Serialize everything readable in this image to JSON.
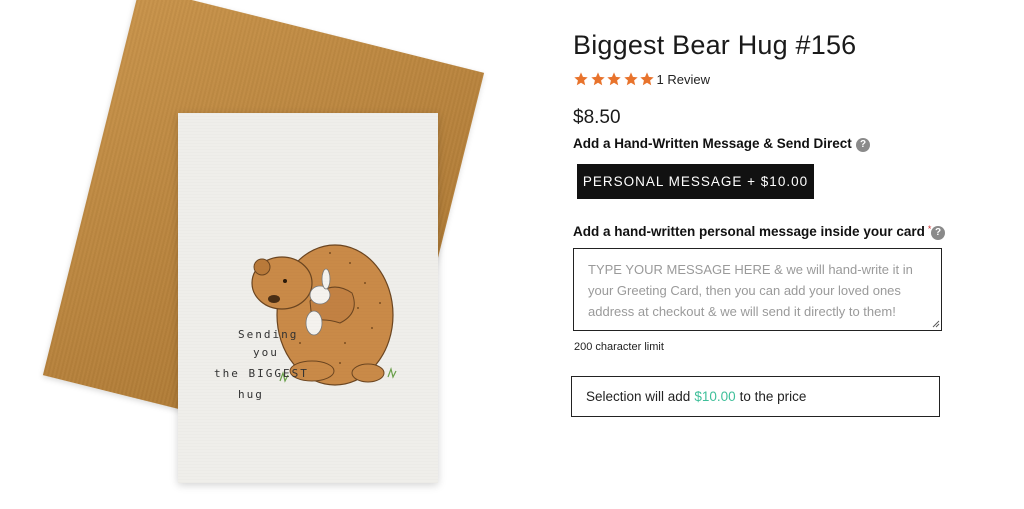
{
  "product": {
    "title": "Biggest Bear Hug #156",
    "rating": 5,
    "rating_max": 5,
    "reviews_label": "1 Review",
    "price": "$8.50"
  },
  "card_art": {
    "line1": "Sending",
    "line2": "you",
    "line3": "the BIGGEST",
    "line4": "hug"
  },
  "addon": {
    "label": "Add a Hand-Written Message & Send Direct",
    "help_icon": "question-mark",
    "option_button_label": "PERSONAL MESSAGE + $10.00"
  },
  "message": {
    "label": "Add a hand-written personal message inside your card",
    "required_mark": "*",
    "help_icon": "question-mark",
    "placeholder": "TYPE YOUR MESSAGE HERE & we will hand-write it in your Greeting Card, then you can add your loved ones address at checkout & we will send it directly to them!",
    "value": "",
    "char_limit": "200 character limit"
  },
  "selection": {
    "prefix": "Selection will add",
    "amount": "$10.00",
    "suffix": "to the price"
  },
  "colors": {
    "star": "#e8732c",
    "accent": "#3fbf9a",
    "button_bg": "#111111",
    "envelope": "#b7823c"
  }
}
